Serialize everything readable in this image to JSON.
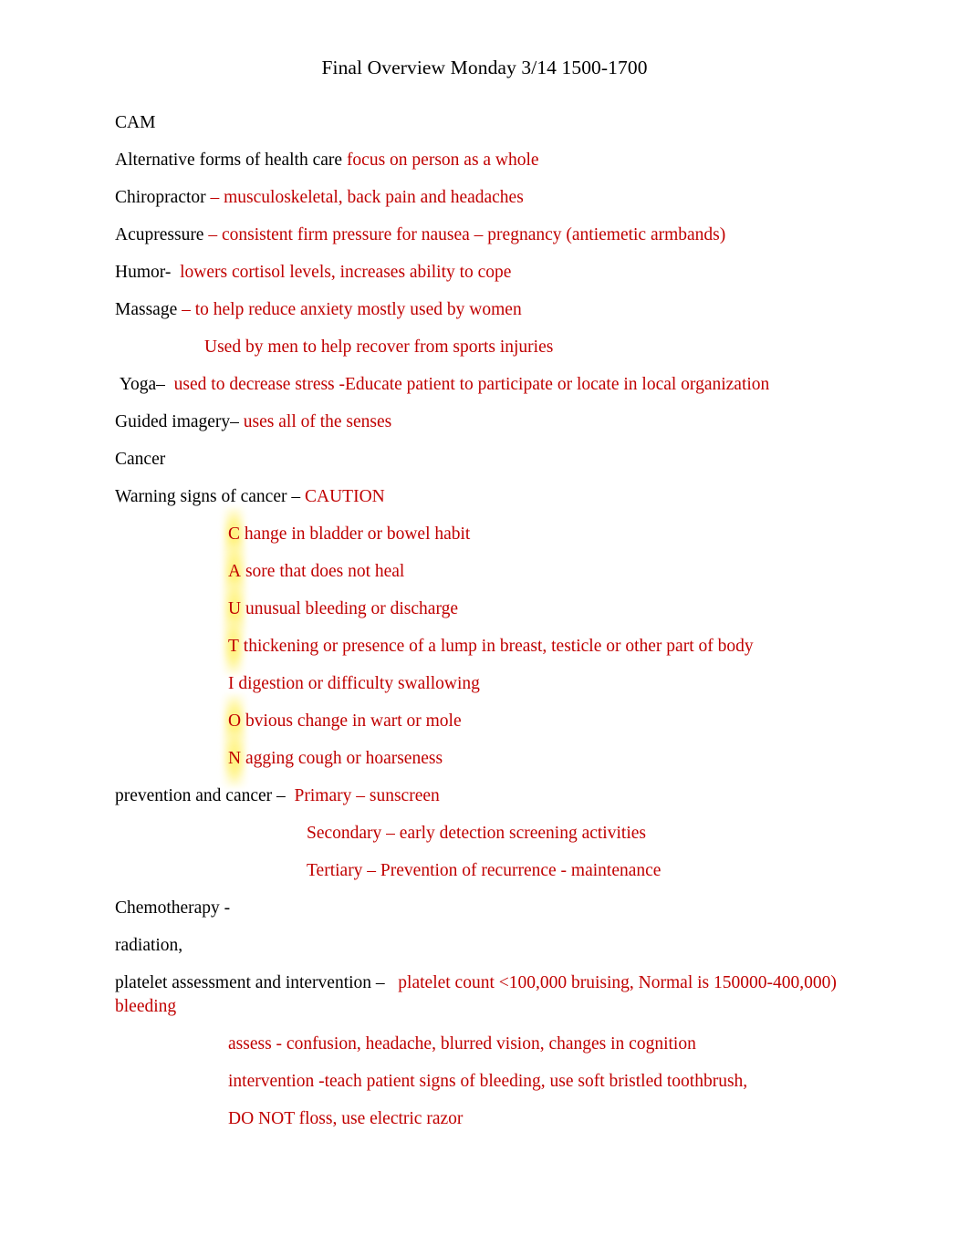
{
  "document": {
    "title": "Final Overview Monday 3/14 1500-1700",
    "accent_red": "#C00000",
    "highlight_yellow": "#FFF064",
    "text_black": "#000000"
  },
  "sections": {
    "cam": {
      "heading": "CAM",
      "alternative_label": "Alternative forms of health care ",
      "alternative_value": "focus on person as a whole",
      "chiropractor_label": "Chiropractor ",
      "chiropractor_value": "– musculoskeletal, back pain and headaches",
      "acupressure_label": "Acupressure ",
      "acupressure_value": "– consistent firm pressure for nausea – pregnancy (antiemetic armbands)",
      "humor_label": "Humor-",
      "humor_value": "  lowers cortisol levels, increases ability to cope",
      "massage_label": "Massage ",
      "massage_value": "– to help reduce anxiety mostly used by women",
      "massage_sub": "Used by men to help recover from sports injuries",
      "yoga_label": " Yoga",
      "yoga_dash": "–",
      "yoga_value": "  used to decrease stress -Educate patient to participate or locate in local organization",
      "guided_imagery_label": "Guided imagery",
      "guided_imagery_dash": "–",
      "guided_imagery_value": " uses all of the senses"
    },
    "cancer": {
      "heading": "Cancer",
      "warning_label": "Warning signs of cancer – ",
      "warning_value": "CAUTION",
      "caution_items": [
        {
          "letter": "C",
          "rest": " hange in bladder or bowel habit",
          "highlighted": true
        },
        {
          "letter": "A",
          "rest": " sore that does not heal",
          "highlighted": true
        },
        {
          "letter": "U",
          "rest": " unusual bleeding or discharge",
          "highlighted": true
        },
        {
          "letter": "T",
          "rest": " thickening or presence of a lump in breast, testicle or other part of body",
          "highlighted": true
        },
        {
          "letter": "I",
          "rest": " digestion or difficulty swallowing",
          "highlighted": false
        },
        {
          "letter": "O",
          "rest": " bvious change in wart or mole",
          "highlighted": true
        },
        {
          "letter": "N",
          "rest": " agging cough or hoarseness",
          "highlighted": true
        }
      ],
      "prevention_label": "prevention and cancer – ",
      "prevention_primary": " Primary – sunscreen",
      "prevention_secondary": "Secondary – early detection screening activities",
      "prevention_tertiary": "Tertiary – Prevention of recurrence - maintenance"
    },
    "treatment": {
      "chemotherapy": "Chemotherapy -",
      "radiation": "radiation,",
      "platelet_label": "platelet assessment and intervention – ",
      "platelet_value": "  platelet count <100,000 bruising, Normal is 150000-400,000) bleeding",
      "assess": "assess - confusion, headache, blurred vision, changes in cognition",
      "intervention": "intervention -teach patient signs of bleeding, use soft bristled toothbrush,",
      "floss": "DO NOT floss, use electric razor"
    }
  }
}
